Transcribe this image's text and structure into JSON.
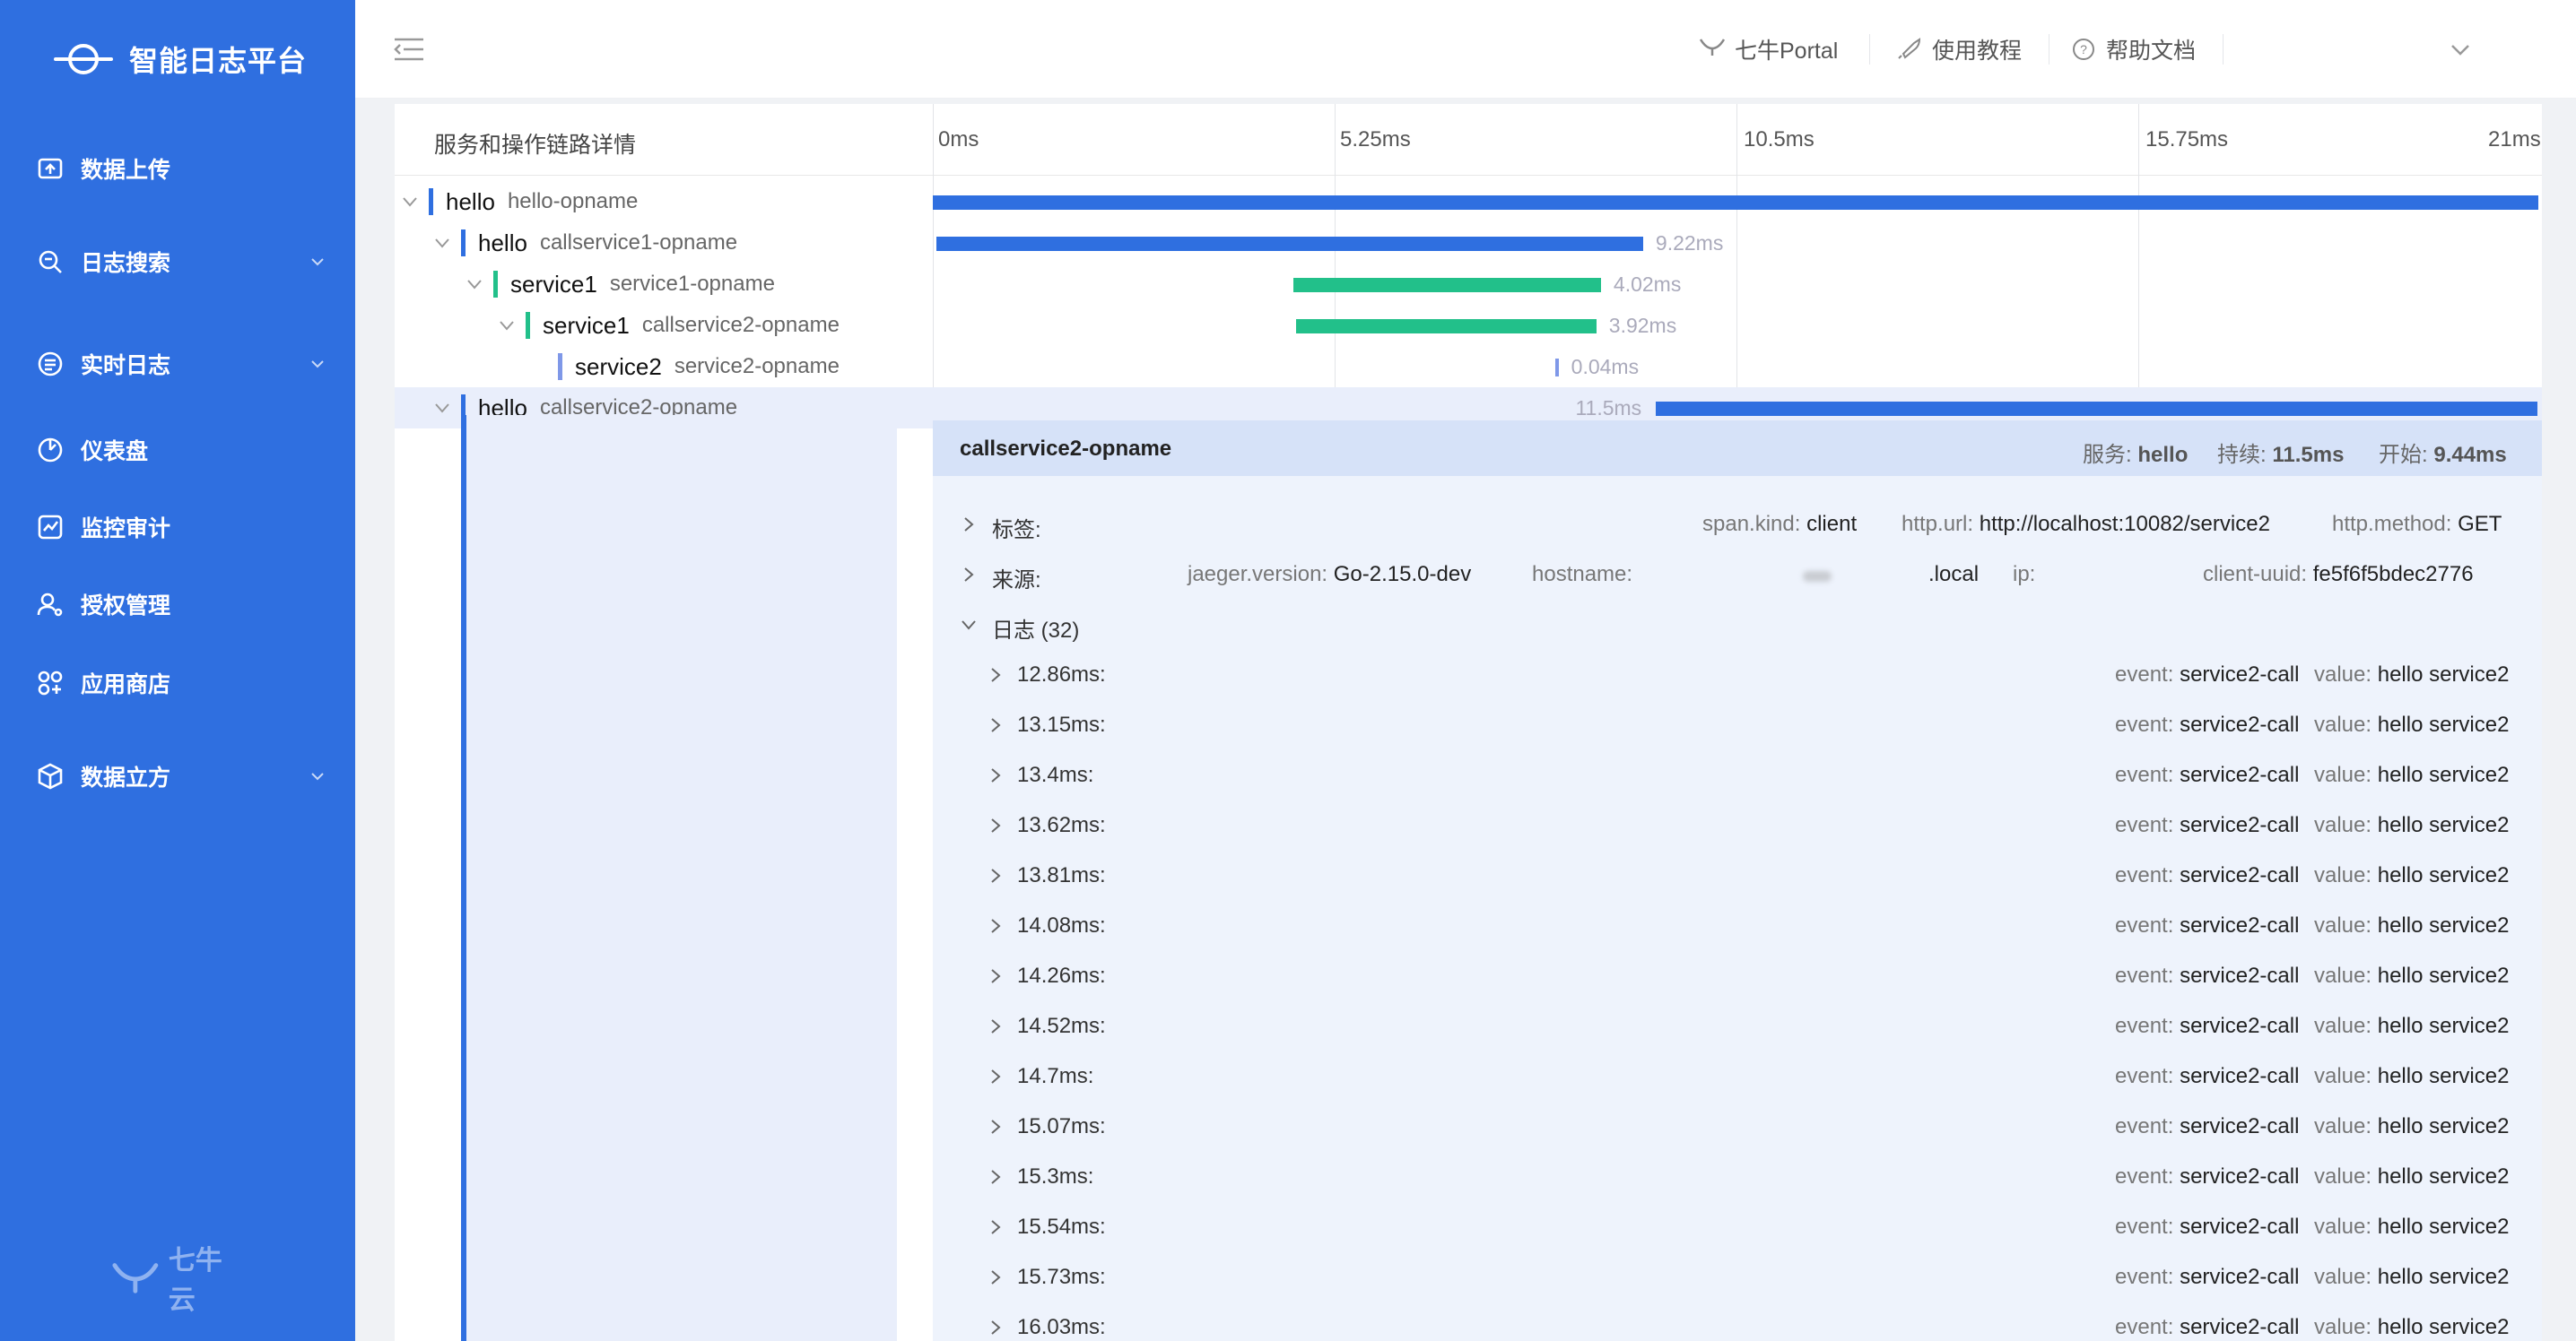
{
  "app": {
    "title": "智能日志平台",
    "bottom_brand": "七牛云"
  },
  "sidebar": {
    "items": [
      {
        "label": "数据上传",
        "icon": "upload-icon",
        "caret": false
      },
      {
        "label": "日志搜索",
        "icon": "search-icon",
        "caret": true
      },
      {
        "label": "实时日志",
        "icon": "list-icon",
        "caret": true
      },
      {
        "label": "仪表盘",
        "icon": "dashboard-icon",
        "caret": false
      },
      {
        "label": "监控审计",
        "icon": "monitor-icon",
        "caret": false
      },
      {
        "label": "授权管理",
        "icon": "user-key-icon",
        "caret": false
      },
      {
        "label": "应用商店",
        "icon": "apps-icon",
        "caret": false
      },
      {
        "label": "数据立方",
        "icon": "cube-icon",
        "caret": true
      }
    ]
  },
  "header": {
    "links": [
      {
        "label": "七牛Portal",
        "icon": "qiniu-icon"
      },
      {
        "label": "使用教程",
        "icon": "rocket-icon"
      },
      {
        "label": "帮助文档",
        "icon": "help-icon"
      }
    ],
    "user": ""
  },
  "trace": {
    "column_title": "服务和操作链路详情",
    "ticks": [
      "0ms",
      "5.25ms",
      "10.5ms",
      "15.75ms",
      "21ms"
    ],
    "total_ms": 21,
    "spans": [
      {
        "service": "hello",
        "op": "hello-opname",
        "depth": 0,
        "toggle": "down",
        "start_ms": 0,
        "dur_ms": 21,
        "dur_label": "",
        "color": "#2f6fe0",
        "mark": "#2f6fe0",
        "label_side": "right"
      },
      {
        "service": "hello",
        "op": "callservice1-opname",
        "depth": 1,
        "toggle": "down",
        "start_ms": 0.05,
        "dur_ms": 9.22,
        "dur_label": "9.22ms",
        "color": "#2f6fe0",
        "mark": "#2f6fe0",
        "label_side": "right"
      },
      {
        "service": "service1",
        "op": "service1-opname",
        "depth": 2,
        "toggle": "down",
        "start_ms": 4.7,
        "dur_ms": 4.02,
        "dur_label": "4.02ms",
        "color": "#22c08a",
        "mark": "#22c08a",
        "label_side": "right"
      },
      {
        "service": "service1",
        "op": "callservice2-opname",
        "depth": 3,
        "toggle": "down",
        "start_ms": 4.74,
        "dur_ms": 3.92,
        "dur_label": "3.92ms",
        "color": "#22c08a",
        "mark": "#22c08a",
        "label_side": "right"
      },
      {
        "service": "service2",
        "op": "service2-opname",
        "depth": 4,
        "toggle": "none",
        "start_ms": 8.12,
        "dur_ms": 0.04,
        "dur_label": "0.04ms",
        "color": "#7f98e8",
        "mark": "#7f98e8",
        "label_side": "right"
      },
      {
        "service": "hello",
        "op": "callservice2-opname",
        "depth": 1,
        "toggle": "down",
        "start_ms": 9.44,
        "dur_ms": 11.5,
        "dur_label": "11.5ms",
        "color": "#2f6fe0",
        "mark": "#2f6fe0",
        "label_side": "left",
        "selected": true
      }
    ]
  },
  "detail": {
    "title": "callservice2-opname",
    "service_k": "服务:",
    "service_v": "hello",
    "duration_k": "持续:",
    "duration_v": "11.5ms",
    "start_k": "开始:",
    "start_v": "9.44ms",
    "tags_label": "标签:",
    "tags": [
      {
        "k": "span.kind:",
        "v": "client"
      },
      {
        "k": "http.url:",
        "v": "http://localhost:10082/service2"
      },
      {
        "k": "http.method:",
        "v": "GET"
      }
    ],
    "process_label": "来源:",
    "process": {
      "jaeger_k": "jaeger.version:",
      "jaeger_v": "Go-2.15.0-dev",
      "hostname_k": "hostname:",
      "hostname_v": ".local",
      "ip_k": "ip:",
      "uuid_k": "client-uuid:",
      "uuid_v": "fe5f6f5bdec2776"
    },
    "logs_label": "日志 (32)",
    "logs": [
      {
        "t": "12.86ms:",
        "event_k": "event:",
        "event_v": "service2-call",
        "value_k": "value:",
        "value_v": "hello service2"
      },
      {
        "t": "13.15ms:",
        "event_k": "event:",
        "event_v": "service2-call",
        "value_k": "value:",
        "value_v": "hello service2"
      },
      {
        "t": "13.4ms:",
        "event_k": "event:",
        "event_v": "service2-call",
        "value_k": "value:",
        "value_v": "hello service2"
      },
      {
        "t": "13.62ms:",
        "event_k": "event:",
        "event_v": "service2-call",
        "value_k": "value:",
        "value_v": "hello service2"
      },
      {
        "t": "13.81ms:",
        "event_k": "event:",
        "event_v": "service2-call",
        "value_k": "value:",
        "value_v": "hello service2"
      },
      {
        "t": "14.08ms:",
        "event_k": "event:",
        "event_v": "service2-call",
        "value_k": "value:",
        "value_v": "hello service2"
      },
      {
        "t": "14.26ms:",
        "event_k": "event:",
        "event_v": "service2-call",
        "value_k": "value:",
        "value_v": "hello service2"
      },
      {
        "t": "14.52ms:",
        "event_k": "event:",
        "event_v": "service2-call",
        "value_k": "value:",
        "value_v": "hello service2"
      },
      {
        "t": "14.7ms:",
        "event_k": "event:",
        "event_v": "service2-call",
        "value_k": "value:",
        "value_v": "hello service2"
      },
      {
        "t": "15.07ms:",
        "event_k": "event:",
        "event_v": "service2-call",
        "value_k": "value:",
        "value_v": "hello service2"
      },
      {
        "t": "15.3ms:",
        "event_k": "event:",
        "event_v": "service2-call",
        "value_k": "value:",
        "value_v": "hello service2"
      },
      {
        "t": "15.54ms:",
        "event_k": "event:",
        "event_v": "service2-call",
        "value_k": "value:",
        "value_v": "hello service2"
      },
      {
        "t": "15.73ms:",
        "event_k": "event:",
        "event_v": "service2-call",
        "value_k": "value:",
        "value_v": "hello service2"
      },
      {
        "t": "16.03ms:",
        "event_k": "event:",
        "event_v": "service2-call",
        "value_k": "value:",
        "value_v": "hello service2"
      }
    ]
  }
}
